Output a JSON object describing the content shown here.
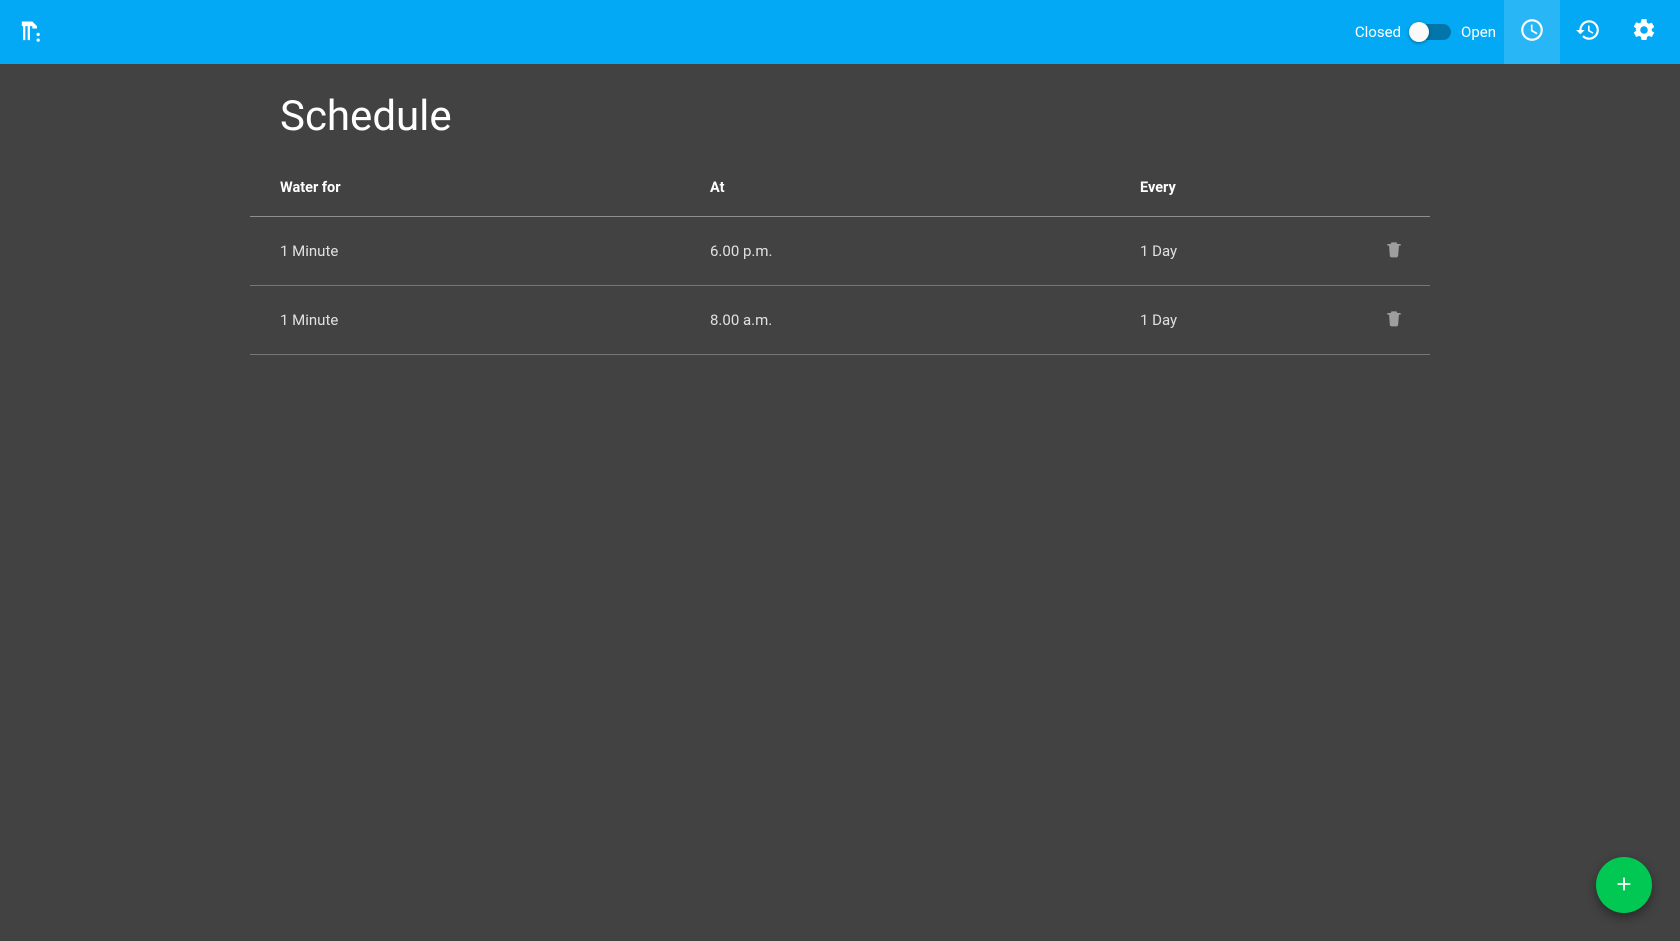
{
  "header": {
    "toggle": {
      "left_label": "Closed",
      "right_label": "Open",
      "state": "closed"
    }
  },
  "page": {
    "title": "Schedule"
  },
  "table": {
    "headers": {
      "duration": "Water for",
      "at": "At",
      "every": "Every"
    },
    "rows": [
      {
        "duration": "1 Minute",
        "at": "6.00 p.m.",
        "every": "1 Day"
      },
      {
        "duration": "1 Minute",
        "at": "8.00 a.m.",
        "every": "1 Day"
      }
    ]
  }
}
